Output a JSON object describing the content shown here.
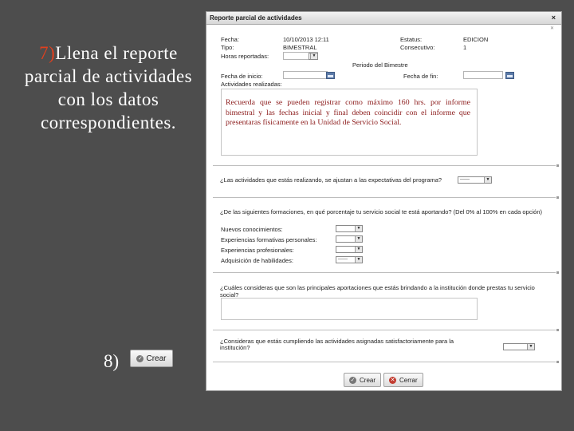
{
  "slide": {
    "step7_num": "7)",
    "step7_text": "Llena el reporte parcial de actividades con los datos correspondientes.",
    "step8_num": "8)",
    "step8_button": "Crear"
  },
  "dialog": {
    "title": "Reporte parcial de actividades",
    "close": "×",
    "fields": {
      "fecha_label": "Fecha:",
      "fecha_value": "10/10/2013 12:11",
      "estatus_label": "Estatus:",
      "estatus_value": "EDICION",
      "tipo_label": "Tipo:",
      "tipo_value": "BIMESTRAL",
      "consecutivo_label": "Consecutivo:",
      "consecutivo_value": "1",
      "horas_label": "Horas reportadas:",
      "periodo_label": "Periodo del Bimestre",
      "inicio_label": "Fecha de inicio:",
      "fin_label": "Fecha de fin:",
      "actividades_label": "Actividades realizadas:"
    },
    "note": "Recuerda que se pueden registrar como máximo 160 hrs. por informe bimestral y las fechas inicial y final deben coincidir con el informe que presentaras físicamente en la Unidad de Servicio Social.",
    "q1": "¿Las actividades que estás realizando, se ajustan a las expectativas del programa?",
    "q1_select": "------",
    "q2": "¿De las siguientes formaciones, en qué porcentaje tu servicio social te está aportando? (Del 0% al 100% en cada opción)",
    "q2_items": [
      "Nuevos conocimientos:",
      "Experiencias formativas personales:",
      "Experiencias profesionales:",
      "Adquisición de habilidades:"
    ],
    "q2_last_select": "------",
    "q3": "¿Cuáles consideras que son las principales aportaciones que estás brindando a la institución donde prestas tu servicio social?",
    "q4": "¿Consideras que estás cumpliendo las actividades asignadas satisfactoriamente para la institución?",
    "btn_crear": "Crear",
    "btn_cerrar": "Cerrar"
  },
  "colors": {
    "background": "#4d4d4d",
    "step_number": "#e0401f",
    "note_text": "#8b1a1a"
  }
}
